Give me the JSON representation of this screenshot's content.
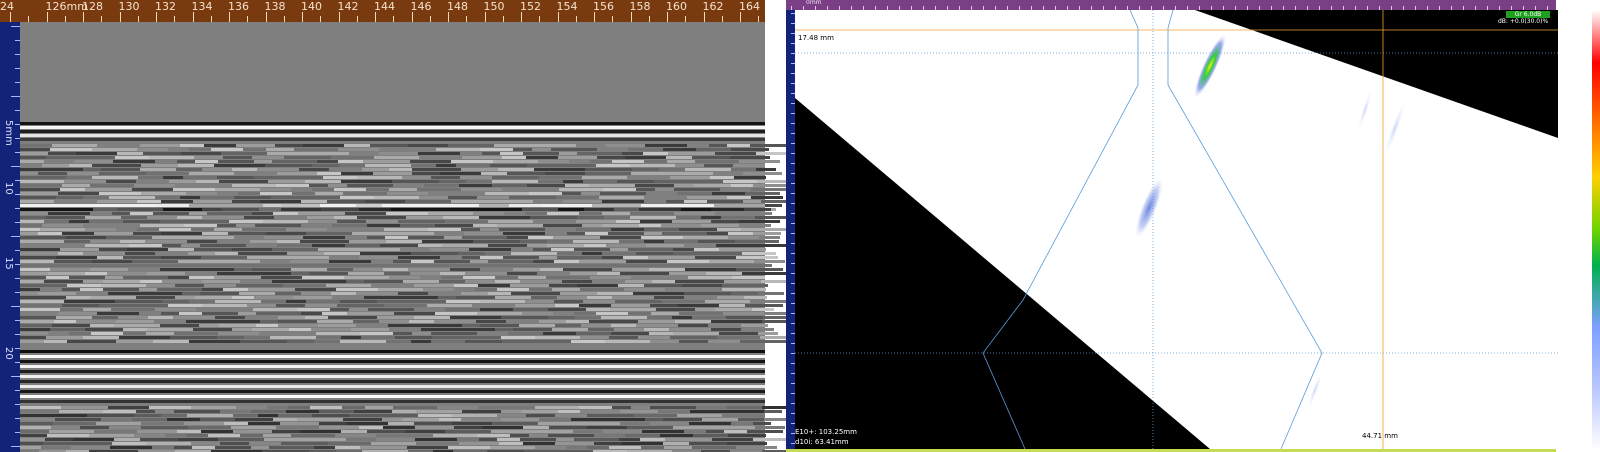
{
  "left_view": {
    "x_axis_labels": [
      "24",
      "126mm",
      "128",
      "130",
      "132",
      "134",
      "136",
      "138",
      "140",
      "142",
      "144",
      "146",
      "148",
      "150",
      "152",
      "154",
      "156",
      "158",
      "160",
      "162",
      "164"
    ],
    "y_axis_labels": [
      "5mm",
      "10",
      "15",
      "20"
    ]
  },
  "right_view": {
    "depth_cursor_label": "17.48 mm",
    "gain_badge": "Gr 6.0dB",
    "db_readout": "dB: +0.0(30.0)%",
    "readout_1": "E10+: 103.25mm",
    "readout_2": "d10i: 63.41mm",
    "bottom_distance": "44.71 mm",
    "origin_label": "0mm",
    "colors": {
      "scan_bg": "#ffffff",
      "shadow": "#000000",
      "ruler_h": "#7b3f86",
      "ruler_v": "#14237a",
      "cursor": "#f0a030",
      "gridline": "#5b9bd5",
      "indication": "#4e6fd8",
      "hot_indication": "#2ecc40"
    }
  }
}
